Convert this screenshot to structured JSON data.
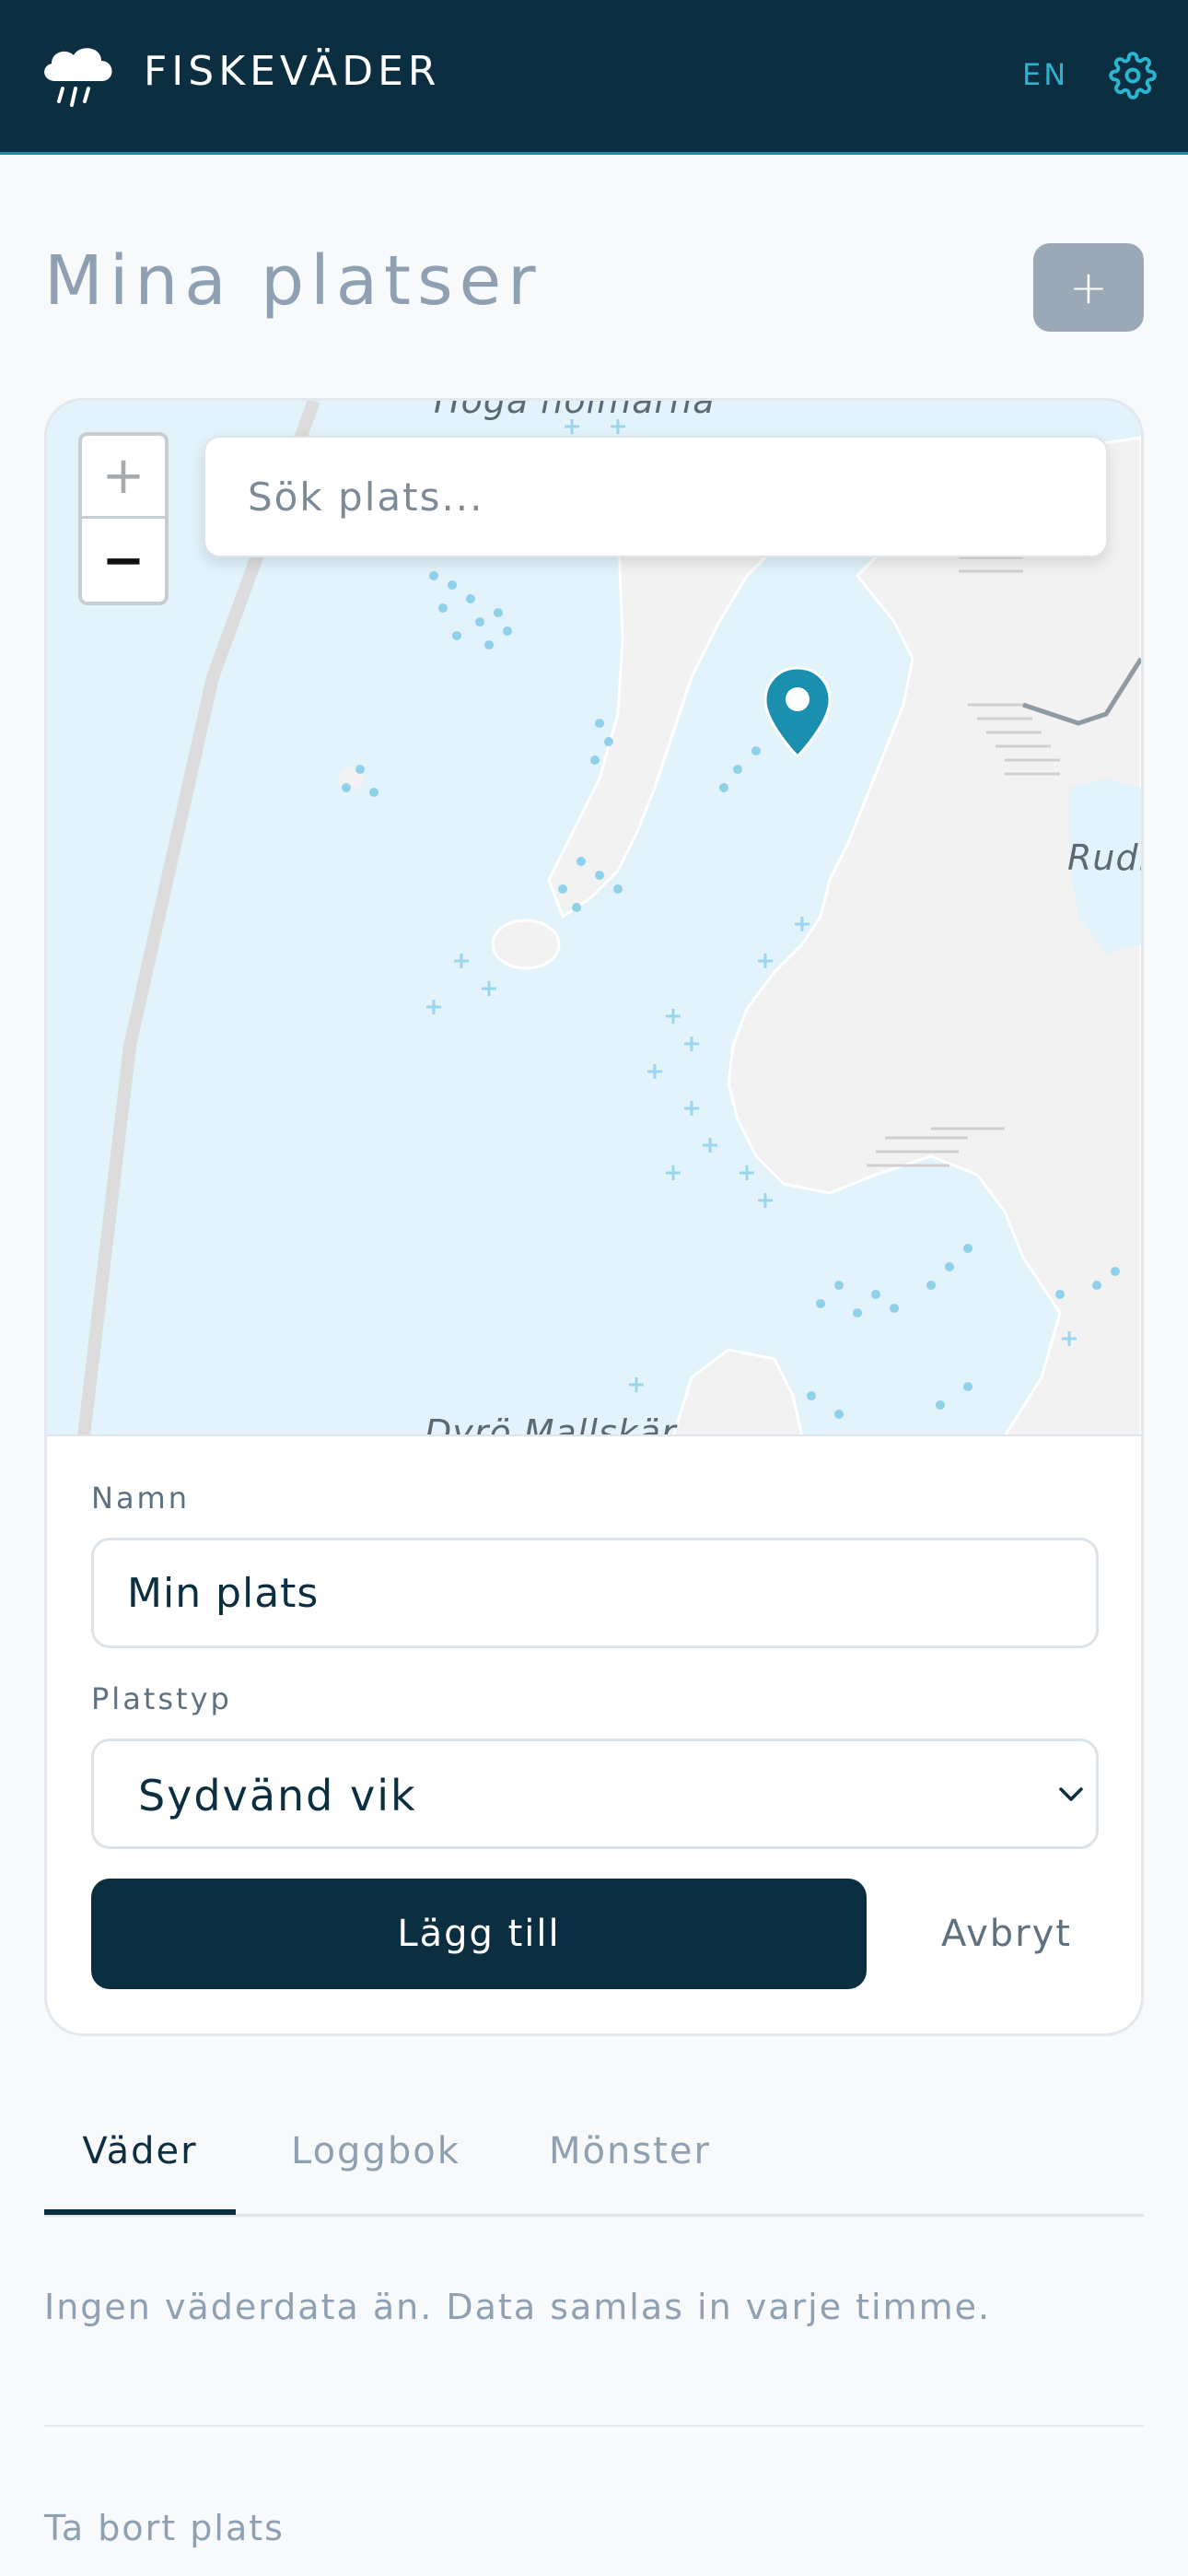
{
  "header": {
    "app_title": "FISKEVÄDER",
    "language_label": "EN",
    "logo_icon": "cloud-rain-icon",
    "settings_icon": "gear-icon"
  },
  "page": {
    "title": "Mina platser",
    "add_label": "+"
  },
  "map": {
    "search_placeholder": "Sök plats...",
    "zoom_in_label": "+",
    "zoom_out_label": "−",
    "place_labels": [
      "Höga holmarna",
      "Rudb",
      "Dyrö Mallskär"
    ],
    "marker_icon": "map-pin-icon",
    "colors": {
      "water": "#e2f3fc",
      "land": "#f2f2f2",
      "pin": "#1a8fae"
    }
  },
  "form": {
    "name_label": "Namn",
    "name_value": "Min plats",
    "type_label": "Platstyp",
    "type_value": "Sydvänd vik",
    "submit_label": "Lägg till",
    "cancel_label": "Avbryt"
  },
  "tabs": [
    {
      "label": "Väder",
      "active": true
    },
    {
      "label": "Loggbok",
      "active": false
    },
    {
      "label": "Mönster",
      "active": false
    }
  ],
  "weather": {
    "empty_message": "Ingen väderdata än. Data samlas in varje timme."
  },
  "footer": {
    "delete_label": "Ta bort plats"
  },
  "colors": {
    "header_bg": "#0b2f40",
    "accent": "#2bb5d0",
    "primary_button": "#0b2f40",
    "muted_text": "#8ea0b2"
  }
}
